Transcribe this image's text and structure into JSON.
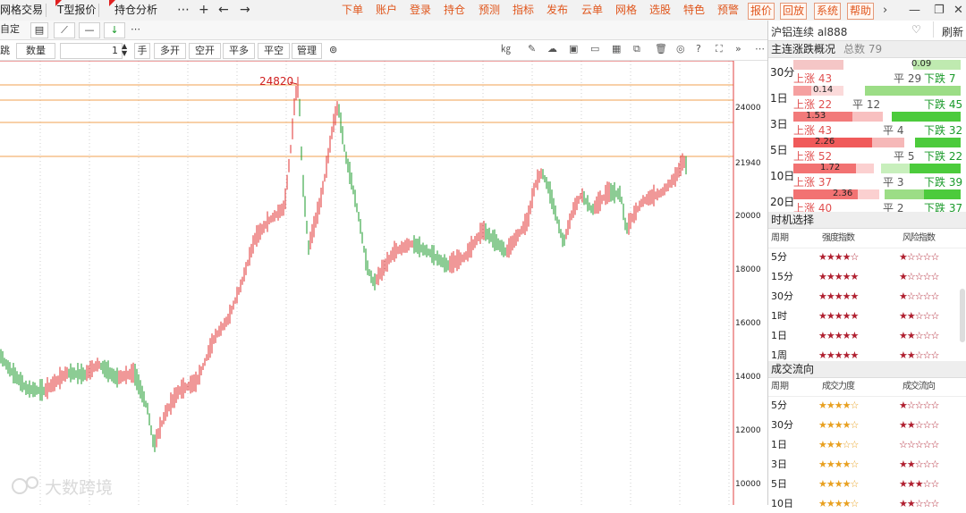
{
  "tabs": [
    {
      "label": "网格交易"
    },
    {
      "label": "T型报价"
    },
    {
      "label": "持仓分析"
    }
  ],
  "menu": {
    "items": [
      "下单",
      "账户",
      "登录",
      "持仓",
      "预测",
      "指标",
      "发布",
      "云单",
      "网格",
      "选股",
      "特色",
      "预警"
    ],
    "boxed": [
      "报价",
      "回放",
      "系统",
      "帮助"
    ]
  },
  "toolbar": {
    "custom": "自定",
    "qty_label": "数量",
    "qty_value": "1",
    "unit": "手",
    "buttons": [
      "多开",
      "空开",
      "平多",
      "平空",
      "管理"
    ],
    "left_cut": "跳"
  },
  "chart": {
    "peak_label": "24820",
    "price_labels": [
      "24000",
      "21940",
      "20000",
      "18000",
      "16000",
      "14000",
      "12000",
      "10000"
    ],
    "watermark": "大数跨境"
  },
  "colors": {
    "up": "#e03030",
    "down": "#1a9a2a",
    "accent": "#e0561c"
  },
  "right": {
    "instrument": "沪铝连续 al888",
    "refresh": "刷新",
    "summary_title": "主连涨跌概况",
    "total": "总数 79",
    "rows": [
      {
        "period": "30分",
        "value": "0.09",
        "up": "上涨 43",
        "flat": "平 29",
        "down": "下跌 7"
      },
      {
        "period": "1日",
        "value": "0.14",
        "up": "上涨 22",
        "flat": "平 12",
        "down": "下跌 45"
      },
      {
        "period": "3日",
        "value": "1.53",
        "up": "上涨 43",
        "flat": "平 4",
        "down": "下跌 32"
      },
      {
        "period": "5日",
        "value": "2.26",
        "up": "上涨 52",
        "flat": "平 5",
        "down": "下跌 22"
      },
      {
        "period": "10日",
        "value": "1.72",
        "up": "上涨 37",
        "flat": "平 3",
        "down": "下跌 39"
      },
      {
        "period": "20日",
        "value": "2.36",
        "up": "上涨 40",
        "flat": "平 2",
        "down": "下跌 37"
      }
    ],
    "timing": {
      "title": "时机选择",
      "headers": [
        "周期",
        "强度指数",
        "风险指数"
      ],
      "rows": [
        {
          "period": "5分",
          "strength": "★★★★☆",
          "risk": "★☆☆☆☆"
        },
        {
          "period": "15分",
          "strength": "★★★★★",
          "risk": "★☆☆☆☆"
        },
        {
          "period": "30分",
          "strength": "★★★★★",
          "risk": "★☆☆☆☆"
        },
        {
          "period": "1时",
          "strength": "★★★★★",
          "risk": "★★☆☆☆"
        },
        {
          "period": "1日",
          "strength": "★★★★★",
          "risk": "★★☆☆☆"
        },
        {
          "period": "1周",
          "strength": "★★★★★",
          "risk": "★★☆☆☆"
        }
      ]
    },
    "flow": {
      "title": "成交流向",
      "headers": [
        "周期",
        "成交力度",
        "成交流向"
      ],
      "rows": [
        {
          "period": "5分",
          "power": "★★★★☆",
          "direction": "★☆☆☆☆"
        },
        {
          "period": "30分",
          "power": "★★★★☆",
          "direction": "★★☆☆☆"
        },
        {
          "period": "1日",
          "power": "★★★☆☆",
          "direction": "☆☆☆☆☆"
        },
        {
          "period": "3日",
          "power": "★★★★☆",
          "direction": "★★☆☆☆"
        },
        {
          "period": "5日",
          "power": "★★★★☆",
          "direction": "★★★☆☆"
        },
        {
          "period": "10日",
          "power": "★★★★☆",
          "direction": "★★☆☆☆"
        }
      ]
    }
  }
}
